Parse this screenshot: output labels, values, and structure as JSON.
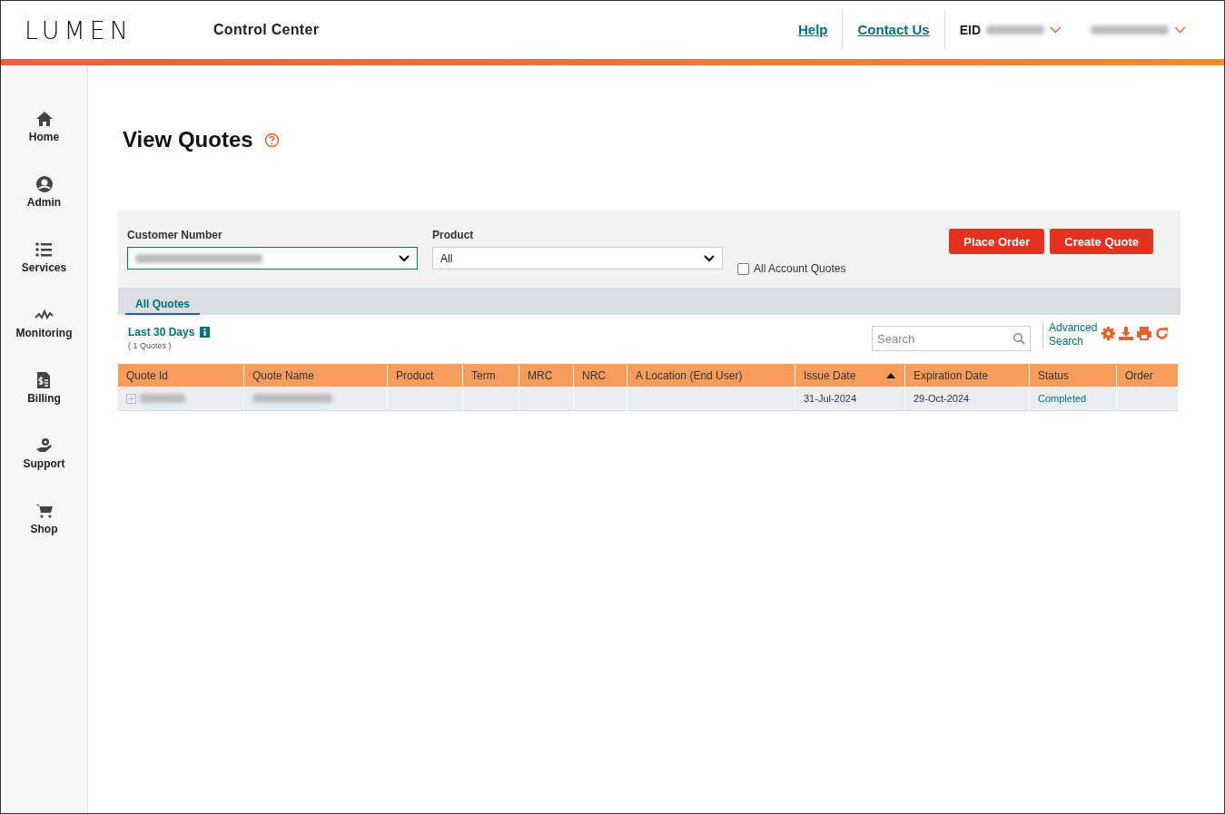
{
  "header": {
    "logo": "LUMEN",
    "app_title": "Control Center",
    "links": [
      "Help",
      "Contact Us"
    ],
    "eid_label": "EID"
  },
  "sidebar": {
    "items": [
      {
        "label": "Home"
      },
      {
        "label": "Admin"
      },
      {
        "label": "Services"
      },
      {
        "label": "Monitoring"
      },
      {
        "label": "Billing"
      },
      {
        "label": "Support"
      },
      {
        "label": "Shop"
      }
    ]
  },
  "page": {
    "title": "View Quotes"
  },
  "filters": {
    "customer_number_label": "Customer Number",
    "product_label": "Product",
    "product_value": "All",
    "all_account_quotes": {
      "label": "All Account Quotes",
      "checked": false
    },
    "buttons": [
      "Place Order",
      "Create Quote"
    ]
  },
  "tabs": [
    {
      "label": "All Quotes",
      "selected": true
    }
  ],
  "list": {
    "range": "Last 30 Days",
    "count": "( 1 Quotes )",
    "search_placeholder": "Search",
    "advanced_search": "Advanced Search"
  },
  "table": {
    "columns": [
      {
        "label": "Quote Id",
        "sorted": false
      },
      {
        "label": "Quote Name",
        "sorted": false
      },
      {
        "label": "Product",
        "sorted": false
      },
      {
        "label": "Term",
        "sorted": false
      },
      {
        "label": "MRC",
        "sorted": false
      },
      {
        "label": "NRC",
        "sorted": false
      },
      {
        "label": "A Location (End User)",
        "sorted": false
      },
      {
        "label": "Issue Date",
        "sorted": true
      },
      {
        "label": "Expiration Date",
        "sorted": false
      },
      {
        "label": "Status",
        "sorted": false
      },
      {
        "label": "Order",
        "sorted": false
      }
    ],
    "rows": [
      {
        "cells": [
          "",
          "",
          "",
          "",
          "",
          "",
          "",
          "31-Jul-2024",
          "29-Oct-2024",
          "Completed",
          ""
        ]
      }
    ]
  }
}
